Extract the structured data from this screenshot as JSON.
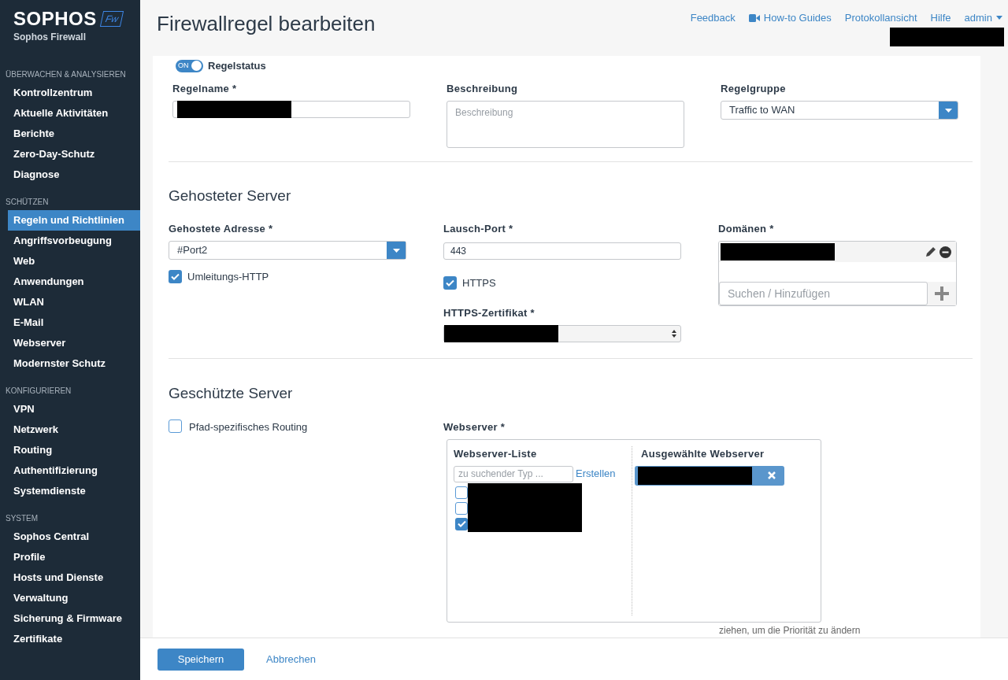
{
  "sidebar": {
    "brand": "SOPHOS",
    "badge": "Fw",
    "product": "Sophos Firewall",
    "sections": [
      {
        "title": "ÜBERWACHEN & ANALYSIEREN",
        "items": [
          {
            "label": "Kontrollzentrum",
            "selected": false
          },
          {
            "label": "Aktuelle Aktivitäten",
            "selected": false
          },
          {
            "label": "Berichte",
            "selected": false
          },
          {
            "label": "Zero-Day-Schutz",
            "selected": false
          },
          {
            "label": "Diagnose",
            "selected": false
          }
        ]
      },
      {
        "title": "SCHÜTZEN",
        "items": [
          {
            "label": "Regeln und Richtlinien",
            "selected": true
          },
          {
            "label": "Angriffsvorbeugung",
            "selected": false
          },
          {
            "label": "Web",
            "selected": false
          },
          {
            "label": "Anwendungen",
            "selected": false
          },
          {
            "label": "WLAN",
            "selected": false
          },
          {
            "label": "E-Mail",
            "selected": false
          },
          {
            "label": "Webserver",
            "selected": false
          },
          {
            "label": "Modernster Schutz",
            "selected": false
          }
        ]
      },
      {
        "title": "KONFIGURIEREN",
        "items": [
          {
            "label": "VPN",
            "selected": false
          },
          {
            "label": "Netzwerk",
            "selected": false
          },
          {
            "label": "Routing",
            "selected": false
          },
          {
            "label": "Authentifizierung",
            "selected": false
          },
          {
            "label": "Systemdienste",
            "selected": false
          }
        ]
      },
      {
        "title": "SYSTEM",
        "items": [
          {
            "label": "Sophos Central",
            "selected": false
          },
          {
            "label": "Profile",
            "selected": false
          },
          {
            "label": "Hosts und Dienste",
            "selected": false
          },
          {
            "label": "Verwaltung",
            "selected": false
          },
          {
            "label": "Sicherung & Firmware",
            "selected": false
          },
          {
            "label": "Zertifikate",
            "selected": false
          }
        ]
      }
    ]
  },
  "header": {
    "title": "Firewallregel bearbeiten",
    "links": [
      {
        "label": "Feedback",
        "kind": "link"
      },
      {
        "label": "How-to Guides",
        "kind": "video"
      },
      {
        "label": "Protokollansicht",
        "kind": "link"
      },
      {
        "label": "Hilfe",
        "kind": "link"
      },
      {
        "label": "admin",
        "kind": "menu"
      }
    ]
  },
  "rule": {
    "toggle": {
      "text": "ON",
      "on": true
    },
    "status_label": "Regelstatus",
    "name_label": "Regelname *",
    "description_label": "Beschreibung",
    "description_placeholder": "Beschreibung",
    "group_label": "Regelgruppe",
    "group_value": "Traffic to WAN"
  },
  "hosted": {
    "title": "Gehosteter Server",
    "address_label": "Gehostete Adresse *",
    "address_value": "#Port2",
    "redirect": {
      "label": "Umleitungs-HTTP",
      "checked": true
    },
    "port_label": "Lausch-Port *",
    "port_value": "443",
    "https": {
      "label": "HTTPS",
      "checked": true
    },
    "cert_label": "HTTPS-Zertifikat *",
    "domains_label": "Domänen *",
    "domains_placeholder": "Suchen / Hinzufügen"
  },
  "protected": {
    "title": "Geschützte Server",
    "path_routing": {
      "label": "Pfad-spezifisches Routing",
      "checked": false
    },
    "webserver_label": "Webserver *",
    "list_title": "Webserver-Liste",
    "search_placeholder": "zu suchender Typ ...",
    "create_link": "Erstellen",
    "list_items": [
      {
        "checked": false
      },
      {
        "checked": false
      },
      {
        "checked": true
      }
    ],
    "selected_title": "Ausgewählte Webserver",
    "hint": "ziehen, um die Priorität zu ändern"
  },
  "footer": {
    "save": "Speichern",
    "cancel": "Abbrechen"
  }
}
